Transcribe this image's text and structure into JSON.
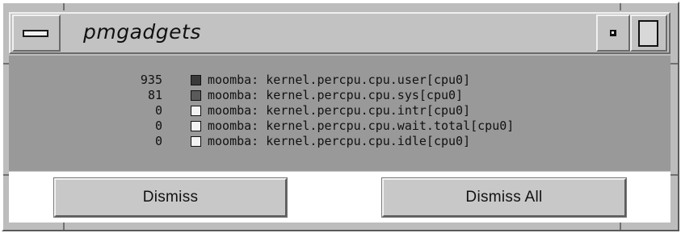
{
  "window": {
    "title": "pmgadgets"
  },
  "metrics": [
    {
      "value": "935",
      "swatch_color": "#3a3a3a",
      "label": "moomba: kernel.percpu.cpu.user[cpu0]"
    },
    {
      "value": "81",
      "swatch_color": "#5a5a5a",
      "label": "moomba: kernel.percpu.cpu.sys[cpu0]"
    },
    {
      "value": "0",
      "swatch_color": "#f2f2f2",
      "label": "moomba: kernel.percpu.cpu.intr[cpu0]"
    },
    {
      "value": "0",
      "swatch_color": "#f2f2f2",
      "label": "moomba: kernel.percpu.cpu.wait.total[cpu0]"
    },
    {
      "value": "0",
      "swatch_color": "#f2f2f2",
      "label": "moomba: kernel.percpu.cpu.idle[cpu0]"
    }
  ],
  "buttons": {
    "dismiss": "Dismiss",
    "dismiss_all": "Dismiss All"
  },
  "icons": {
    "window_menu": "window-menu-icon",
    "minimize": "minimize-icon",
    "maximize": "maximize-icon"
  },
  "colors": {
    "panel_bg": "#999999",
    "chrome_bg": "#c2c2c2"
  }
}
